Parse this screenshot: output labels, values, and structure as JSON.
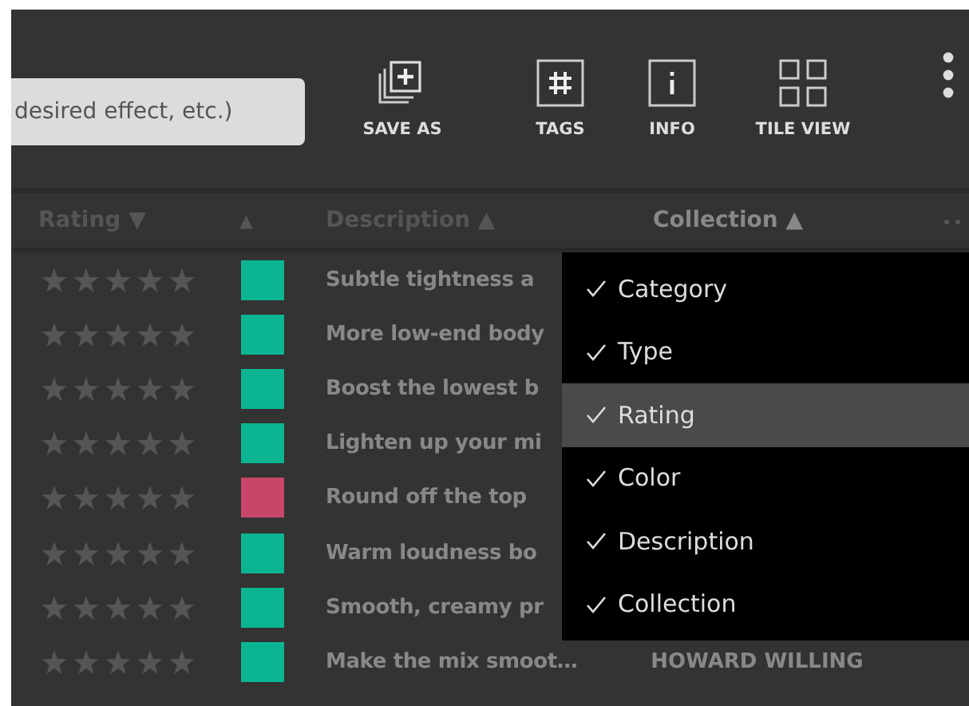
{
  "search": {
    "placeholder": "desired effect, etc.)"
  },
  "toolbar": [
    {
      "kind": "save",
      "label": "SAVE AS"
    },
    {
      "kind": "tags",
      "label": "TAGS"
    },
    {
      "kind": "info",
      "label": "INFO"
    },
    {
      "kind": "tiles",
      "label": "TILE VIEW"
    }
  ],
  "columns": [
    {
      "label": "Rating ▼"
    },
    {
      "label": "▲"
    },
    {
      "label": "Description ▲"
    },
    {
      "label": "Collection ▲"
    }
  ],
  "rows": [
    {
      "stars": 0,
      "color": "#0bb592",
      "description": "Subtle tightness a"
    },
    {
      "stars": 0,
      "color": "#0bb592",
      "description": "More low-end body"
    },
    {
      "stars": 0,
      "color": "#0bb592",
      "description": "Boost the lowest b"
    },
    {
      "stars": 0,
      "color": "#0bb592",
      "description": "Lighten up your mi"
    },
    {
      "stars": 0,
      "color": "#c9466b",
      "description": "Round off the top"
    },
    {
      "stars": 0,
      "color": "#0bb592",
      "description": "Warm loudness bo"
    },
    {
      "stars": 0,
      "color": "#0bb592",
      "description": "Smooth, creamy pr"
    },
    {
      "stars": 0,
      "color": "#0bb592",
      "description": "Make the mix smoot…",
      "collection": "HOWARD WILLING"
    }
  ],
  "menu": [
    {
      "label": "Category",
      "checked": true,
      "selected": false
    },
    {
      "label": "Type",
      "checked": true,
      "selected": false
    },
    {
      "label": "Rating",
      "checked": true,
      "selected": true
    },
    {
      "label": "Color",
      "checked": true,
      "selected": false
    },
    {
      "label": "Description",
      "checked": true,
      "selected": false
    },
    {
      "label": "Collection",
      "checked": true,
      "selected": false
    }
  ]
}
